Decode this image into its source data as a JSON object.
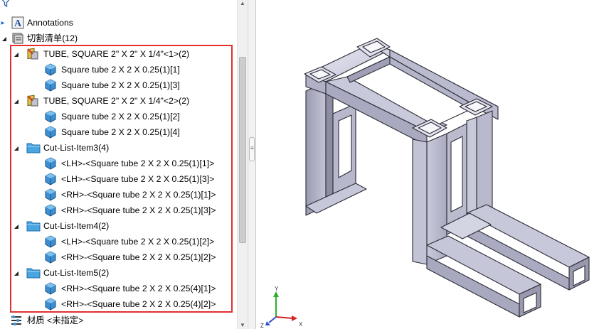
{
  "tree": {
    "annotations": "Annotations",
    "cutlist_root": "切割清单(12)",
    "groups": [
      {
        "label": "TUBE, SQUARE 2\" X 2\" X 1/4\"<1>(2)",
        "icon": "weldment-tube-icon",
        "items": [
          "Square tube 2 X 2 X 0.25(1)[1]",
          "Square tube 2 X 2 X 0.25(1)[3]"
        ]
      },
      {
        "label": "TUBE, SQUARE 2\" X 2\" X 1/4\"<2>(2)",
        "icon": "weldment-tube-icon",
        "items": [
          "Square tube 2 X 2 X 0.25(1)[2]",
          "Square tube 2 X 2 X 0.25(1)[4]"
        ]
      },
      {
        "label": "Cut-List-Item3(4)",
        "icon": "folder-icon",
        "items": [
          "<LH>-<Square tube 2 X 2 X 0.25(1)[1]>",
          "<LH>-<Square tube 2 X 2 X 0.25(1)[3]>",
          "<RH>-<Square tube 2 X 2 X 0.25(1)[1]>",
          "<RH>-<Square tube 2 X 2 X 0.25(1)[3]>"
        ]
      },
      {
        "label": "Cut-List-Item4(2)",
        "icon": "folder-icon",
        "items": [
          "<LH>-<Square tube 2 X 2 X 0.25(1)[2]>",
          "<RH>-<Square tube 2 X 2 X 0.25(1)[2]>"
        ]
      },
      {
        "label": "Cut-List-Item5(2)",
        "icon": "folder-icon",
        "items": [
          "<RH>-<Square tube 2 X 2 X 0.25(4)[1]>",
          "<RH>-<Square tube 2 X 2 X 0.25(4)[2]>"
        ]
      }
    ],
    "material": "材质 <未指定>"
  },
  "triad": {
    "x": "X",
    "y": "Y",
    "z": "Z"
  },
  "colors": {
    "highlight": "#e03030",
    "body_face": "#c9cad9",
    "body_edge": "#2a2a35",
    "cube_blue": "#3d8fd1",
    "folder_blue": "#4aa6e0"
  }
}
